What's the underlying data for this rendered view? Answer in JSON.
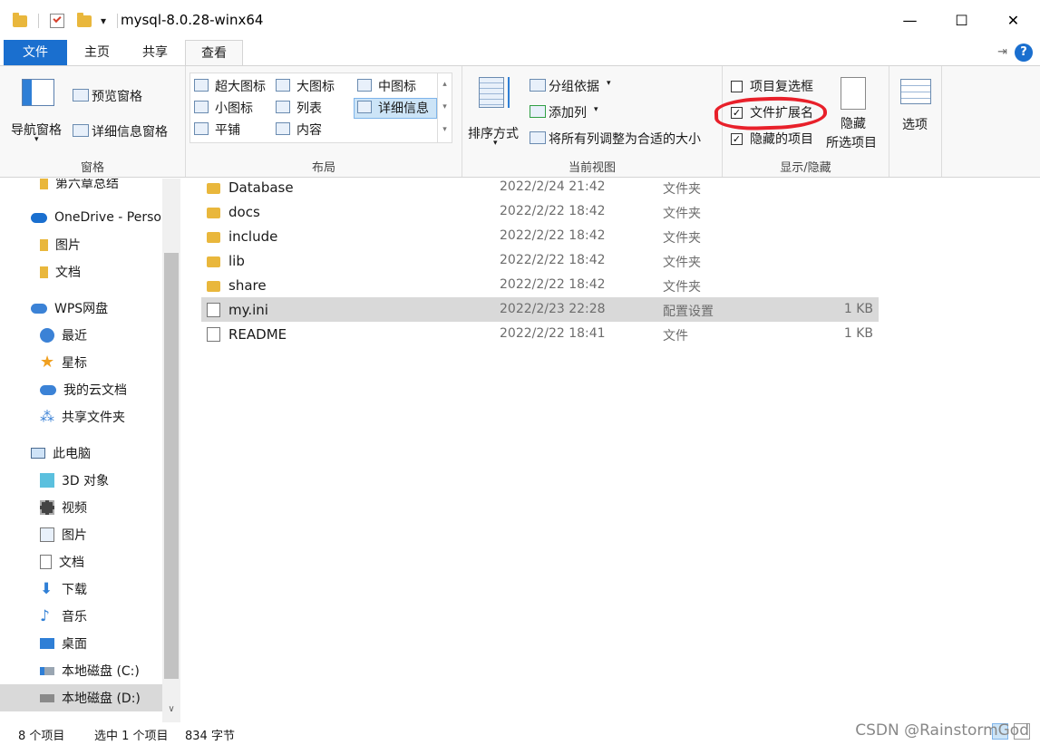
{
  "titlebar": {
    "title": "mysql-8.0.28-winx64",
    "dropdown_glyph": "▾",
    "minimize": "—",
    "maximize": "☐",
    "close": "✕"
  },
  "tabs": {
    "file": "文件",
    "home": "主页",
    "share": "共享",
    "view": "查看",
    "pin_glyph": "⇥",
    "help": "?"
  },
  "ribbon": {
    "panes": {
      "label": "窗格",
      "nav_pane": "导航窗格",
      "preview_pane": "预览窗格",
      "details_pane": "详细信息窗格"
    },
    "layout": {
      "label": "布局",
      "items": [
        "超大图标",
        "大图标",
        "中图标",
        "小图标",
        "列表",
        "详细信息",
        "平铺",
        "内容"
      ]
    },
    "current_view": {
      "label": "当前视图",
      "sort_by": "排序方式",
      "group_by": "分组依据",
      "add_column": "添加列",
      "fit_columns": "将所有列调整为合适的大小"
    },
    "show_hide": {
      "label": "显示/隐藏",
      "item_checkboxes": "项目复选框",
      "item_checkboxes_checked": false,
      "file_extensions": "文件扩展名",
      "file_extensions_checked": true,
      "hidden_items": "隐藏的项目",
      "hidden_items_checked": true,
      "hide_selected_line1": "隐藏",
      "hide_selected_line2": "所选项目"
    },
    "options": "选项",
    "annotation_color": "#e8202a"
  },
  "nav": {
    "items": [
      {
        "label": "第六章总结",
        "icon": "folder-icon"
      },
      {
        "label": "OneDrive - Personal",
        "icon": "cloud-icon"
      },
      {
        "label": "图片",
        "icon": "folder-icon"
      },
      {
        "label": "文档",
        "icon": "folder-icon"
      },
      {
        "label": "WPS网盘",
        "icon": "wps-cloud-icon"
      },
      {
        "label": "最近",
        "icon": "clock-icon"
      },
      {
        "label": "星标",
        "icon": "star-icon"
      },
      {
        "label": "我的云文档",
        "icon": "cloud-doc-icon"
      },
      {
        "label": "共享文件夹",
        "icon": "share-folder-icon"
      },
      {
        "label": "此电脑",
        "icon": "computer-icon"
      },
      {
        "label": "3D 对象",
        "icon": "cube-icon"
      },
      {
        "label": "视频",
        "icon": "video-icon"
      },
      {
        "label": "图片",
        "icon": "picture-icon"
      },
      {
        "label": "文档",
        "icon": "document-icon"
      },
      {
        "label": "下载",
        "icon": "download-icon"
      },
      {
        "label": "音乐",
        "icon": "music-icon"
      },
      {
        "label": "桌面",
        "icon": "desktop-icon"
      },
      {
        "label": "本地磁盘 (C:)",
        "icon": "drive-c-icon"
      },
      {
        "label": "本地磁盘 (D:)",
        "icon": "drive-d-icon"
      }
    ]
  },
  "files": {
    "rows": [
      {
        "name": "Database",
        "date": "2022/2/24 21:42",
        "type": "文件夹",
        "size": ""
      },
      {
        "name": "docs",
        "date": "2022/2/22 18:42",
        "type": "文件夹",
        "size": ""
      },
      {
        "name": "include",
        "date": "2022/2/22 18:42",
        "type": "文件夹",
        "size": ""
      },
      {
        "name": "lib",
        "date": "2022/2/22 18:42",
        "type": "文件夹",
        "size": ""
      },
      {
        "name": "share",
        "date": "2022/2/22 18:42",
        "type": "文件夹",
        "size": ""
      },
      {
        "name": "my.ini",
        "date": "2022/2/23 22:28",
        "type": "配置设置",
        "size": "1 KB"
      },
      {
        "name": "README",
        "date": "2022/2/22 18:41",
        "type": "文件",
        "size": "1 KB"
      }
    ]
  },
  "status": {
    "count": "8 个项目",
    "selected": "选中 1 个项目",
    "size": "834 字节"
  },
  "watermark": "CSDN @RainstormGod"
}
